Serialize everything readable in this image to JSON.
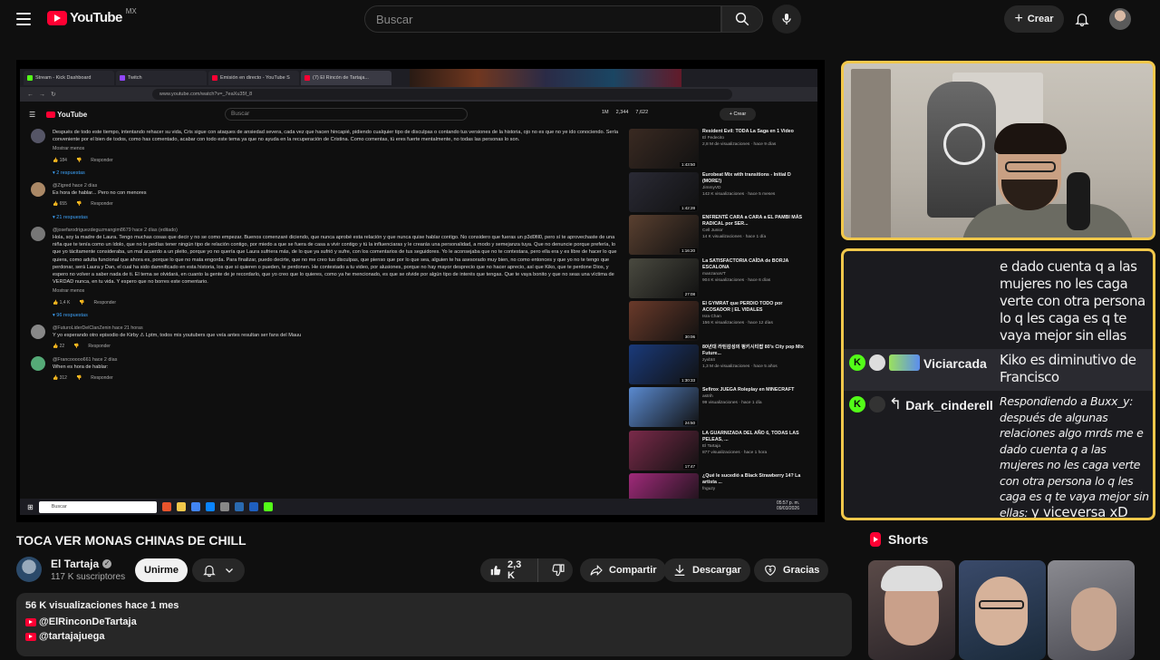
{
  "header": {
    "logo_text": "YouTube",
    "country_code": "MX",
    "search_placeholder": "Buscar",
    "create_label": "Crear"
  },
  "inner_browser": {
    "tabs": [
      {
        "label": "Stream - Kick Dashboard",
        "color": "#53fc18"
      },
      {
        "label": "Twitch",
        "color": "#9146ff"
      },
      {
        "label": "Emisión en directo - YouTube S",
        "color": "#ff0033"
      },
      {
        "label": "(7) El Rincón de Tartaja...",
        "color": "#ff0033"
      }
    ],
    "url": "www.youtube.com/watch?v=_7eaXu35f_8",
    "youtube_logo": "YouTube",
    "search_placeholder": "Buscar",
    "stats": [
      "1M",
      "2,344",
      "7,622"
    ],
    "create_label": "+ Crear",
    "comments": [
      {
        "author": "",
        "text": "Después de todo este tiempo, intentando rehacer su vida, Cris sigue con ataques de ansiedad severa, cada vez que hacen hincapié, pidiendo cualquier tipo de disculpas o contando tus versiones de la historia, ojo no es que no ye ido conociendo. Sería conveniente por el bien de todos, como has comentado, acabar con todo este tema ya que no ayuda en la recuperación de Cristina. Como comentas, tú eres fuerte mentalmente, no todas las personas lo son.",
        "more": "Mostrar menos",
        "likes": "184",
        "reply": "Responder",
        "replies": "2 respuestas",
        "avatar": "#556"
      },
      {
        "author": "@Zigred  hace 2 días",
        "text": "Es hora de hablar... Pero no con menores",
        "more": "",
        "likes": "655",
        "reply": "Responder",
        "replies": "21 respuestas",
        "avatar": "#a86"
      },
      {
        "author": "@josefarodriguezdeguzmangim8679  hace 2 días (editado)",
        "text": "Hola, soy la madre de Laura. Tengo muchas cosas que decir y no se como empezar. Buenos comenzaré diciendo, que nunca aprobé esta relación y que nunca quise hablar contigo. No considero que fueras un p3d0fil0, pero sí te aprovechaste de una niña que te tenía como un ídolo, que no le pedías tener ningún tipo de relación contigo, por miedo a que se fuera de casa a vivir contigo y tú la influenciaras y le crearás una personalidad, a modo y semejanza tuya. Que no denuncie porque prefería, lo que yo tácitamente consideraba, un mal acuerdo a un pleito, porque yo no quería que Laura sufriera más, de lo que ya sufrió y sufre, con los comentarios de tus seguidores. Yo le aconsejaba que no te contestara, pero ella era y es libre de hacer lo que quiera, como adulta funcional que ahora es, porque lo que no mata engorda. Para finalizar, puedo decirte, que no me creo tus disculpas, que pienso que por lo que sea, alguien te ha asesorado muy bien, no como entonces y que yo no te tengo que perdonar, será Laura y Dan, el cual ha sido damnificado en esta historia, los que si quieren o pueden, te perdonen. He contestado a tu video, por alusiones, porque no hay mayor desprecio que no hacer aprecio, así que Kiko, que te perdone Dios, y espero no volver a saber nada de ti. El tema se olvidará, en cuanto la gente de je recordarlo, que yo creo que lo quieres, como ya he mencionado, es que se olvide por algún tipo de interés que tengas. Que te vaya bonito y que no seas una víctima de VERDAD nunca, en tu vida. Y espero que no borres este comentario.",
        "more": "Mostrar menos",
        "likes": "1,4 K",
        "reply": "Responder",
        "replies": "96 respuestas",
        "avatar": "#777"
      },
      {
        "author": "@FuturoLiderDelClanZenin  hace 21 horas",
        "text": "Y yo esperando otro episodio de Kirby ⚠ Lptm, todos mis youtubers que veía antes resultan ser fans del Mauu",
        "more": "",
        "likes": "22",
        "reply": "Responder",
        "replies": "",
        "avatar": "#888"
      },
      {
        "author": "@Francooooo661  hace 2 días",
        "text": "When es hora de hablar:",
        "more": "",
        "likes": "312",
        "reply": "Responder",
        "replies": "",
        "avatar": "#5a7"
      }
    ],
    "side_videos": [
      {
        "title": "Resident Evil: TODA La Saga en 1 Video",
        "channel": "El Fedecito",
        "meta": "2,8 M de visualizaciones · hace 9 días",
        "duration": "1:43:50",
        "color": "#3a2a22"
      },
      {
        "title": "Eurobeat Mix with transitions - Initial D (MORE!)",
        "channel": "JimmyVD",
        "meta": "142 K visualizaciones · hace 5 meses",
        "duration": "1:42:28",
        "color": "#2a2a35"
      },
      {
        "title": "ENFRENTÉ CARA a CARA a EL PAMBI MÁS RADICAL por SER...",
        "channel": "Cell Junior",
        "meta": "14 K visualizaciones · hace 1 día",
        "duration": "1:16:20",
        "color": "#5a4030"
      },
      {
        "title": "La SATISFACTORIA CAÍDA de BORJA ESCALONA",
        "channel": "manzanaVT",
        "meta": "904 K visualizaciones · hace 6 días",
        "duration": "27:08",
        "color": "#4a4a40"
      },
      {
        "title": "El GYMRAT que PERDIO TODO por ACOSADOR | EL VIDALES",
        "channel": "Isra Chan",
        "meta": "156 K visualizaciones · hace 12 días",
        "duration": "30:06",
        "color": "#6a3a2a"
      },
      {
        "title": "80년대 라틴감성의 펑키시티팝 80's City pop Mix Future...",
        "channel": "zyxbt4",
        "meta": "1,3 M de visualizaciones · hace 5 años",
        "duration": "1:30:33",
        "color": "#1a3a7a"
      },
      {
        "title": "Sefirox JUEGA Roleplay en MINECRAFT",
        "channel": "astrih",
        "meta": "99 visualizaciones · hace 1 día",
        "duration": "24:50",
        "color": "#5a8ad0"
      },
      {
        "title": "LA GUARNIZADA DEL AÑO 6, TODAS LAS PELEAS, ...",
        "channel": "El Tartaja",
        "meta": "877 visualizaciones · hace 1 hora",
        "duration": "17:47",
        "color": "#7a2a4a"
      },
      {
        "title": "¿Qué le sucedió a Black Strawberry 14? La artista ...",
        "channel": "fnguzy",
        "meta": "",
        "duration": "",
        "color": "#a02a7a"
      }
    ],
    "taskbar_search": "Buscar",
    "clock_time": "05:57 p. m.",
    "clock_date": "09/03/2026"
  },
  "video": {
    "title": "TOCA VER MONAS CHINAS DE CHILL",
    "channel_name": "El Tartaja",
    "subscribers": "117 K suscriptores",
    "join_label": "Unirme",
    "likes": "2,3 K",
    "share_label": "Compartir",
    "download_label": "Descargar",
    "thanks_label": "Gracias",
    "views_time": "56 K visualizaciones  hace 1 mes",
    "links": [
      "@ElRinconDeTartaja",
      "@tartajajuega"
    ]
  },
  "chat": {
    "continuation": "e dado cuenta q a las mujeres no les caga verte con otra persona lo q les caga es q te vaya mejor sin ellas",
    "messages": [
      {
        "user": "Viciarcada",
        "text": "Kiko es diminutivo de Francisco"
      },
      {
        "user": "Dark_cinderell",
        "reply_prefix": "Respondiendo a Buxx_y: después de algunas relaciones algo mrds me e dado cuenta q a las mujeres no les caga verte con otra persona lo q les caga es q te vaya mejor sin ellas:",
        "text": "y viceversa xD"
      }
    ]
  },
  "shorts": {
    "heading": "Shorts"
  },
  "colors": {
    "accent": "#ff0033",
    "frame": "#f2c84b",
    "kick": "#53fc18",
    "link": "#3ea6ff"
  }
}
